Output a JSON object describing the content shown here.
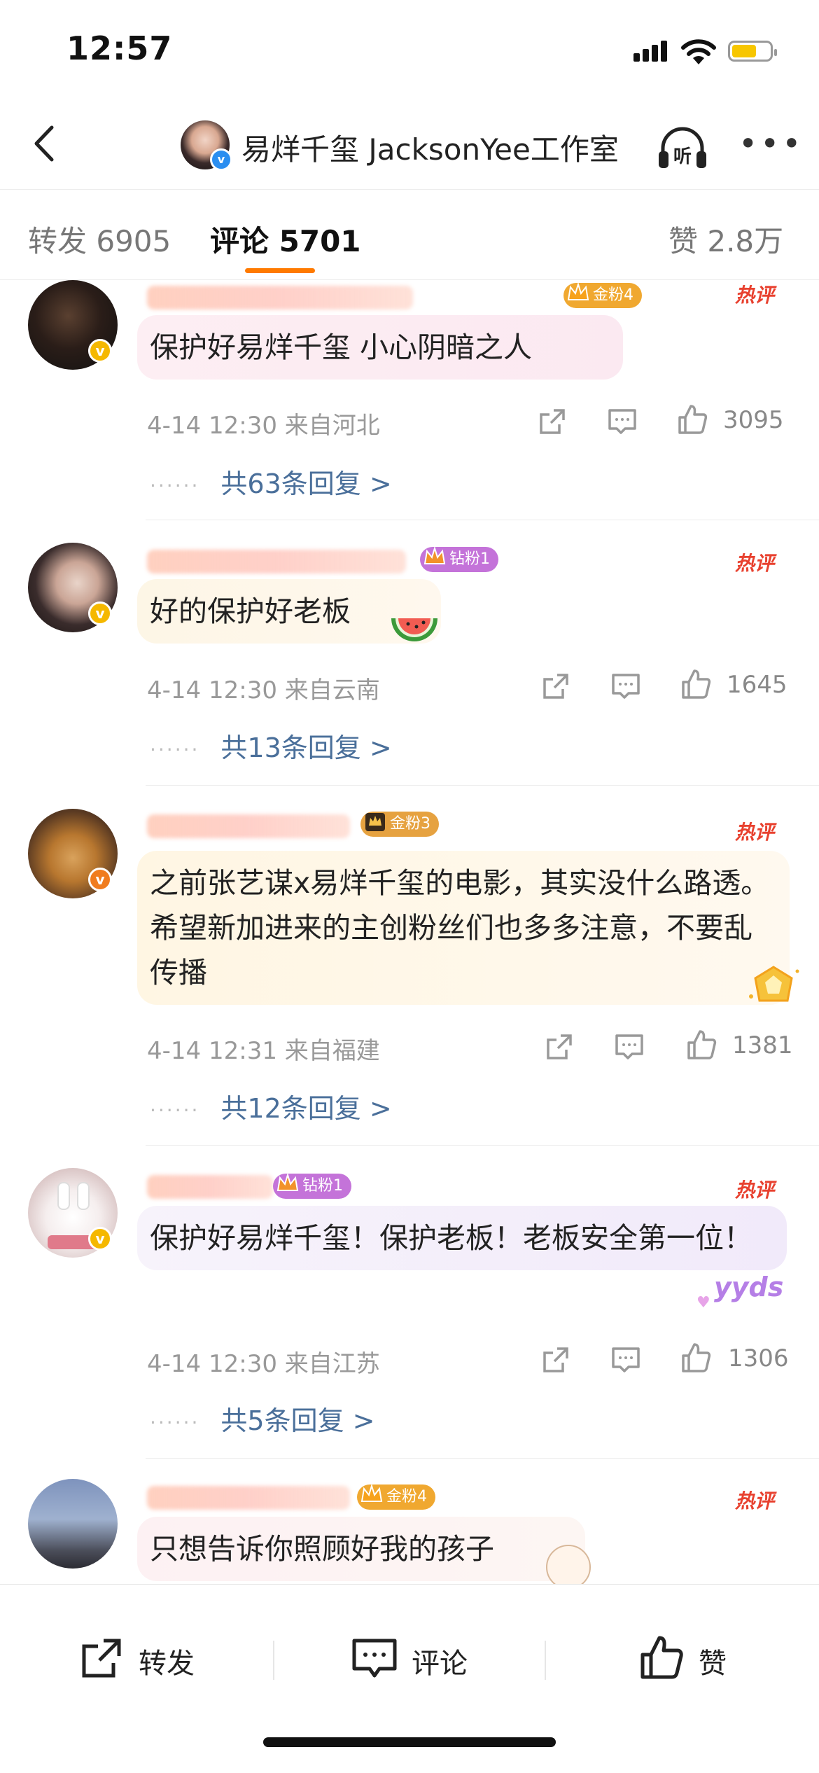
{
  "status_bar": {
    "time": "12:57"
  },
  "nav": {
    "title": "易烊千玺 JacksonYee工作室",
    "listen_label": "听"
  },
  "tabs": [
    {
      "label": "转发 6905"
    },
    {
      "label": "评论 5701"
    },
    {
      "label": "赞 2.8万"
    }
  ],
  "comments": [
    {
      "fan_badge": "金粉4",
      "text": "保护好易烊千玺 小心阴暗之人",
      "time_loc": "4-14 12:30 来自河北",
      "likes": "3095",
      "replies": "共63条回复 >",
      "hot": "热评"
    },
    {
      "fan_badge": "钻粉1",
      "text": "好的保护好老板",
      "time_loc": "4-14 12:30 来自云南",
      "likes": "1645",
      "replies": "共13条回复 >",
      "hot": "热评"
    },
    {
      "fan_badge": "金粉3",
      "text": "之前张艺谋x易烊千玺的电影，其实没什么路透。希望新加进来的主创粉丝们也多多注意，不要乱传播",
      "time_loc": "4-14 12:31 来自福建",
      "likes": "1381",
      "replies": "共12条回复 >",
      "hot": "热评"
    },
    {
      "fan_badge": "钻粉1",
      "text": "保护好易烊千玺！保护老板！老板安全第一位！",
      "time_loc": "4-14 12:30 来自江苏",
      "likes": "1306",
      "replies": "共5条回复 >",
      "hot": "热评"
    },
    {
      "fan_badge": "金粉4",
      "text": "只想告诉你照顾好我的孩子",
      "hot": "热评"
    }
  ],
  "bottom_bar": {
    "repost": "转发",
    "comment": "评论",
    "like": "赞"
  },
  "decorations": {
    "yyds_sticker": "yyds"
  },
  "colors": {
    "accent": "#ff7a00",
    "hot": "#e8412f",
    "link": "#4a6f9a",
    "verified": "#f5b800"
  }
}
